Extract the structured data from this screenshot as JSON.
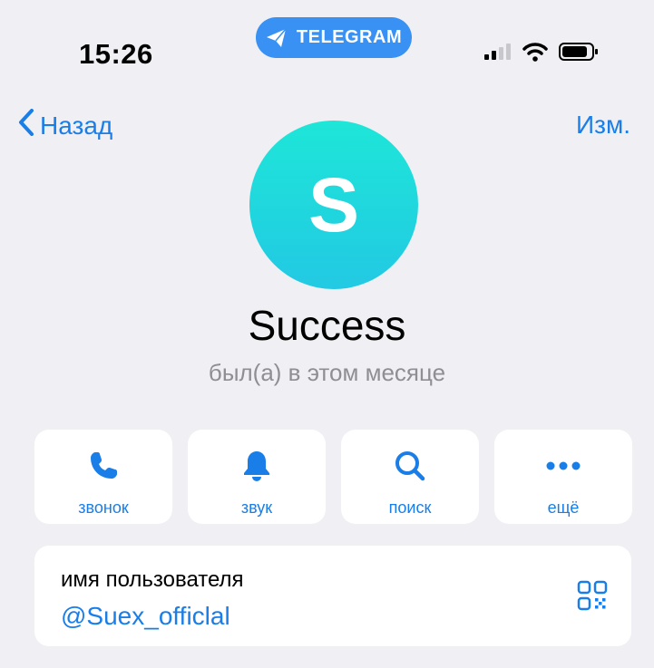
{
  "status_bar": {
    "time": "15:26",
    "app_pill": "TELEGRAM",
    "icons": [
      "signal-icon",
      "wifi-icon",
      "battery-icon"
    ]
  },
  "nav": {
    "back_label": "Назад",
    "edit_label": "Изм."
  },
  "profile": {
    "avatar_letter": "S",
    "name": "Success",
    "status": "был(а) в этом месяце"
  },
  "actions": [
    {
      "label": "звонок",
      "icon": "phone-icon"
    },
    {
      "label": "звук",
      "icon": "bell-icon"
    },
    {
      "label": "поиск",
      "icon": "search-icon"
    },
    {
      "label": "ещё",
      "icon": "more-icon"
    }
  ],
  "username_card": {
    "label": "имя пользователя",
    "value": "@Suex_officlal",
    "icon": "qr-code-icon"
  },
  "colors": {
    "accent": "#1a7ee8",
    "background": "#efeff4",
    "pill": "#3891f3",
    "avatar_gradient_top": "#1ee6d8",
    "avatar_gradient_bottom": "#22c9e3",
    "secondary_text": "#8e8e93"
  }
}
